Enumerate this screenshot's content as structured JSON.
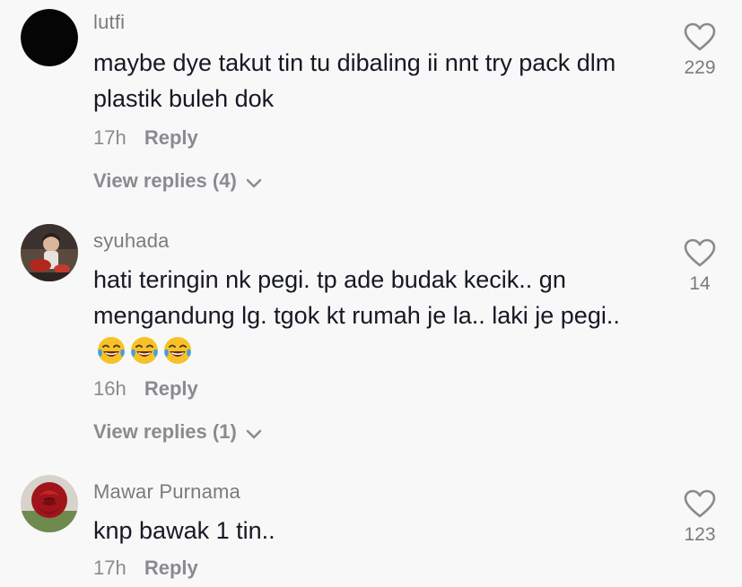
{
  "comments": [
    {
      "username": "lutfi",
      "text": "maybe dye takut tin tu dibaling ii nnt try pack dlm plastik buleh dok",
      "time": "17h",
      "reply_label": "Reply",
      "view_replies": "View replies (4)",
      "likes": "229",
      "avatar": "black-circle"
    },
    {
      "username": "syuhada",
      "text": "hati teringin nk pegi. tp ade budak kecik.. gn mengandung lg. tgok kt rumah je la.. laki je pegi..",
      "emojis": [
        "face-with-tears-of-joy",
        "face-with-tears-of-joy",
        "face-with-tears-of-joy"
      ],
      "time": "16h",
      "reply_label": "Reply",
      "view_replies": "View replies (1)",
      "likes": "14",
      "avatar": "child-photo"
    },
    {
      "username": "Mawar Purnama",
      "text": "knp bawak 1 tin..",
      "time": "17h",
      "reply_label": "Reply",
      "likes": "123",
      "avatar": "red-rose-photo"
    }
  ],
  "colors": {
    "background": "#f8f8f8",
    "primary_text": "#161823",
    "secondary_text": "#8a8b91"
  }
}
